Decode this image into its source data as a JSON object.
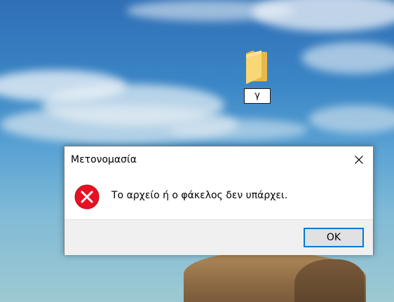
{
  "desktop": {
    "folder_icon": "folder-icon",
    "rename_value": "γ"
  },
  "dialog": {
    "title": "Μετονομασία",
    "close_icon": "close-icon",
    "error_icon": "error-icon",
    "message": "Το αρχείο ή ο φάκελος δεν υπάρχει.",
    "ok_label": "OK"
  },
  "colors": {
    "accent": "#0078d7",
    "error_red": "#e81123",
    "folder_yellow": "#f8d775"
  }
}
